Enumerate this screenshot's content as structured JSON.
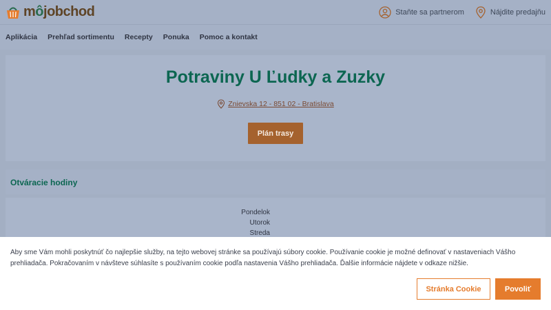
{
  "header": {
    "logo_text_prefix": "m",
    "logo_text_o": "ô",
    "logo_text_suffix": "jobchod",
    "partner_label": "Staňte sa partnerom",
    "find_store_label": "Nájdite predajňu"
  },
  "nav": {
    "items": [
      "Aplikácia",
      "Prehľad sortimentu",
      "Recepty",
      "Ponuka",
      "Pomoc a kontakt"
    ]
  },
  "shop": {
    "title": "Potraviny U Ľudky a Zuzky",
    "address": "Znievska 12 - 851 02 - Bratislava",
    "route_button": "Plán trasy"
  },
  "hours": {
    "title": "Otváracie hodiny",
    "days": [
      "Pondelok",
      "Utorok",
      "Streda"
    ]
  },
  "cookie": {
    "text": "Aby sme Vám mohli poskytnúť čo najlepšie služby, na tejto webovej stránke sa používajú súbory cookie. Používanie cookie je možné definovať v nastaveniach Vášho prehliadača. Pokračovaním v návšteve súhlasíte s používaním cookie podľa nastavenia Vášho prehliadača. Ďalšie informácie nájdete v odkaze nižšie.",
    "cookie_page_button": "Stránka Cookie",
    "allow_button": "Povoliť"
  },
  "colors": {
    "brand_green": "#0c6651",
    "brand_orange": "#e57c2d",
    "brown": "#5e4426"
  }
}
